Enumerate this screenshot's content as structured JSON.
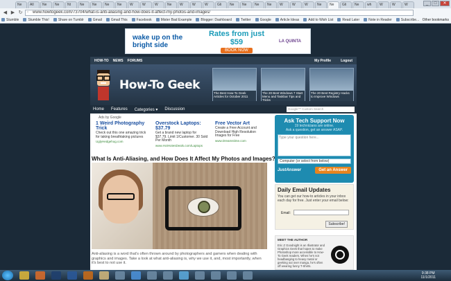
{
  "browser": {
    "tabs": [
      "Ne",
      "All",
      "Ne",
      "Ne",
      "Nt",
      "Ne",
      "Ne",
      "Ne",
      "Ne",
      "W",
      "W",
      "W",
      "Ne",
      "W",
      "W",
      "W",
      "Gli",
      "Ne",
      "Ne",
      "Ne",
      "Ne",
      "W",
      "W",
      "W",
      "Ne",
      "Ne",
      "Gli",
      "Ne",
      "wh",
      "W",
      "W",
      "W"
    ],
    "url": "www.howtogeek.com/73704/what-is-anti-aliasing-and-how-does-it-affect-my-photos-and-images/",
    "bookmarks": [
      "Stumble",
      "Stumble This!",
      "Share on Tumblr",
      "Gmail",
      "Gmail This",
      "Facebook",
      "Mister Bad Example",
      "Blogger: Dashboard",
      "Twitter",
      "Google",
      "Article Ideas",
      "Add to Wish List",
      "Read Later",
      "Note in Reader",
      "Subscribe..."
    ],
    "other_bookmarks": "Other bookmarks"
  },
  "ad_banner": {
    "headline": "wake up on the bright side",
    "offer": "Rates from just $59",
    "button": "BOOK NOW",
    "brand": "LA QUINTA"
  },
  "site": {
    "topnav": [
      "HOW-TO",
      "NEWS",
      "FORUMS"
    ],
    "user_links": [
      "My Profile",
      "Logout"
    ],
    "logo": "How-To Geek",
    "featured": [
      "The Best How-To Geek Articles for October 2011",
      "The 20 Best Windows 7 Start Menu and Taskbar Tips and Tricks",
      "The 20 Best Registry Hacks to Improve Windows"
    ],
    "menu": [
      "Home",
      "Features",
      "Categories ▾",
      "Discussion"
    ],
    "search_placeholder": "Google™ Custom Search"
  },
  "ads": {
    "by": "Ads by Google",
    "items": [
      {
        "title": "1 Weird Photography Trick",
        "desc": "Check out this one amazing trick for taking breathtaking pictures",
        "url": "UglyHedgehog.com"
      },
      {
        "title": "Overstock Laptops: $37.79",
        "desc": "Get a brand new laptop for $37.79. Limit 1/Customer. 30 Sold Per Month",
        "url": "www.HotHotesDeals.com/Laptops"
      },
      {
        "title": "Free Vector Art",
        "desc": "Create a Free Account and Download High Resolution Images for Free",
        "url": "www.Dreamstime.com"
      }
    ]
  },
  "article": {
    "title": "What Is Anti-Aliasing, and How Does It Affect My Photos and Images?",
    "excerpt": "Anti-aliasing is a word that's often thrown around by photographers and gamers when dealing with graphics and images. Take a look at what anti-aliasing is, why we use it, and, most importantly, when it's best to not use it."
  },
  "ask": {
    "title": "Ask Tech Support Now",
    "sub1": "19 technicians are online.",
    "sub2": "Ask a question, get an answer ASAP.",
    "placeholder": "Type your question here...",
    "select": "Computer (or select from below)",
    "brand": "JustAnswer",
    "button": "Get an Answer"
  },
  "email": {
    "title": "Daily Email Updates",
    "desc": "You can get our how-to articles in your inbox each day for free. Just enter your email below:",
    "label": "Email:",
    "button": "Subscribe!"
  },
  "author": {
    "heading": "MEET THE AUTHOR",
    "bio": "Eric Z Goodnight is an Illustrator and Graphics Geek that hopes to make Photoshop more accessible to How-To Geek readers. When he's not headbanging to heavy metal or geeking out over manga, he's often off wearing funny T-Shirts."
  },
  "taskbar": {
    "time": "9:38 PM",
    "date": "11/1/2011"
  }
}
